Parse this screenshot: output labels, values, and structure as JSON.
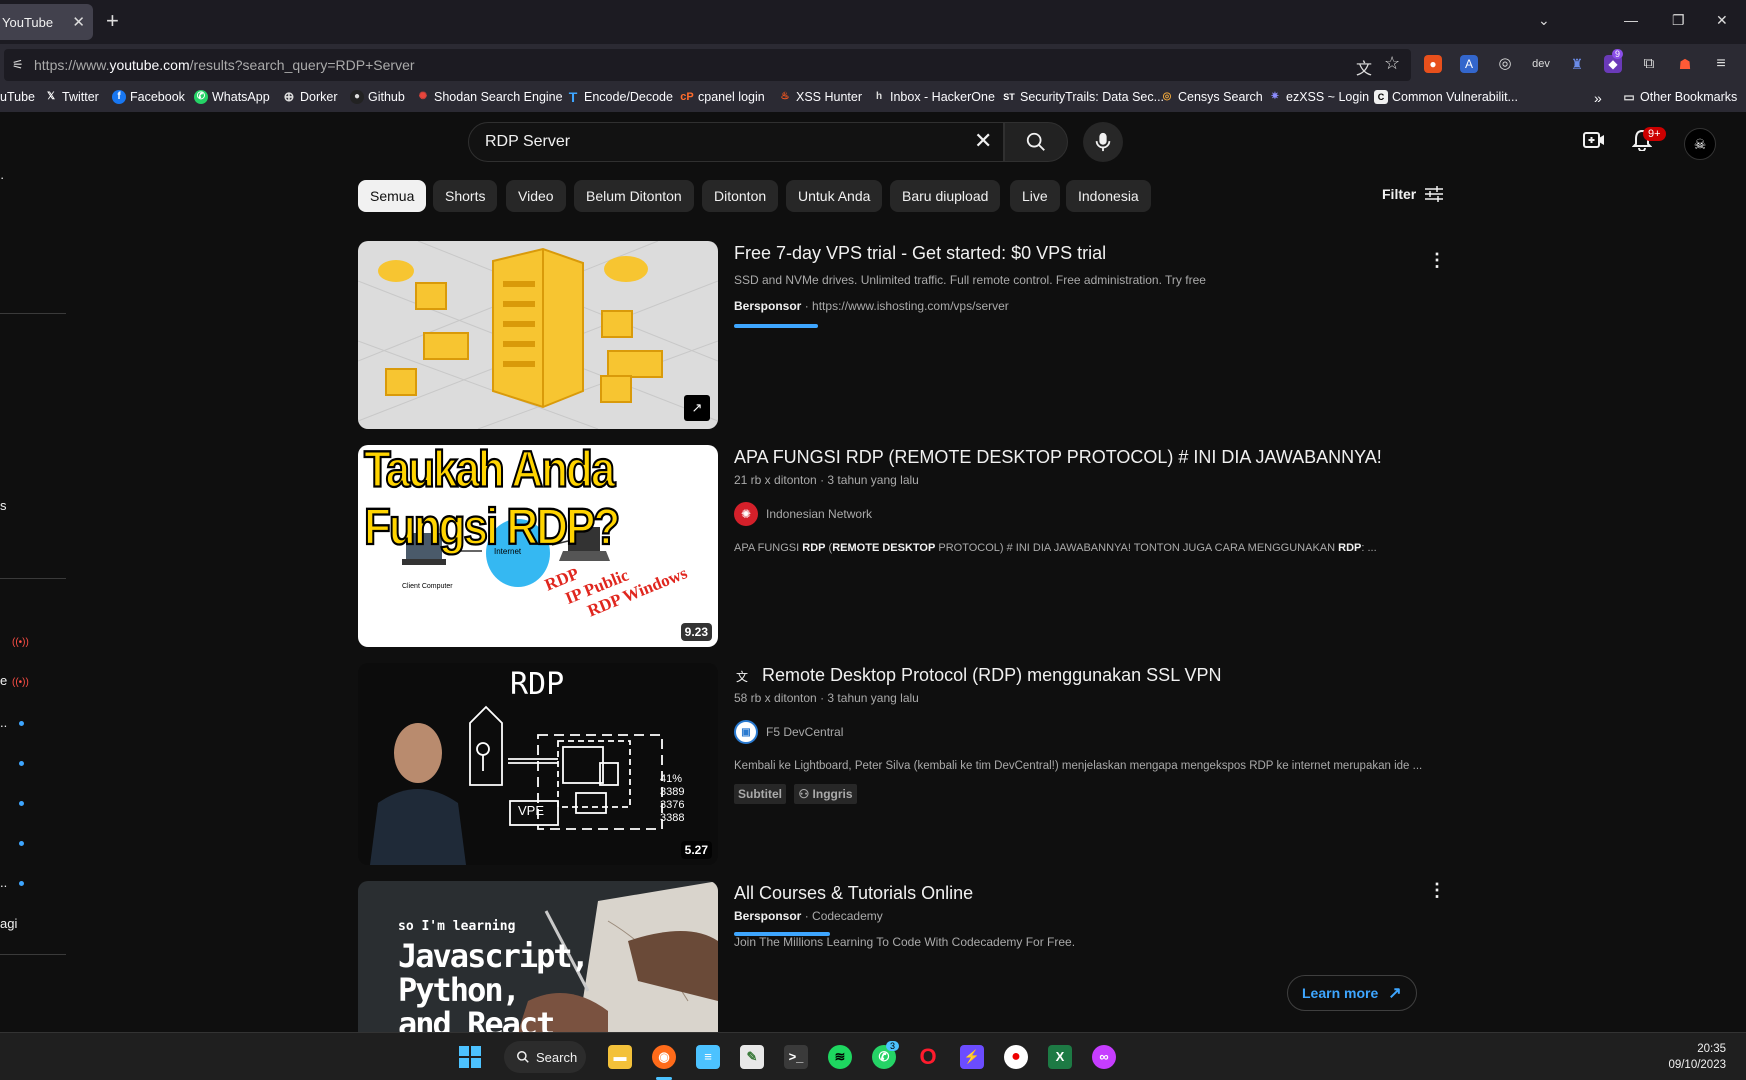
{
  "browser": {
    "tab_title": "YouTube",
    "url_prefix": "https://www.",
    "url_host": "youtube.com",
    "url_path": "/results?search_query=RDP+Server"
  },
  "bookmarks": [
    {
      "label": "uTube",
      "icon": "youtube-icon"
    },
    {
      "label": "Twitter",
      "icon": "x-icon"
    },
    {
      "label": "Facebook",
      "icon": "facebook-icon"
    },
    {
      "label": "WhatsApp",
      "icon": "whatsapp-icon"
    },
    {
      "label": "Dorker",
      "icon": "globe-icon"
    },
    {
      "label": "Github",
      "icon": "github-icon"
    },
    {
      "label": "Shodan Search Engine",
      "icon": "shodan-icon"
    },
    {
      "label": "Encode/Decode",
      "icon": "t-icon"
    },
    {
      "label": "cpanel login",
      "icon": "cpanel-icon"
    },
    {
      "label": "XSS Hunter",
      "icon": "flame-icon"
    },
    {
      "label": "Inbox - HackerOne",
      "icon": "hackerone-icon"
    },
    {
      "label": "SecurityTrails: Data Sec...",
      "icon": "st-icon"
    },
    {
      "label": "Censys Search",
      "icon": "censys-icon"
    },
    {
      "label": "ezXSS ~ Login",
      "icon": "ezxss-icon"
    },
    {
      "label": "Common Vulnerabilit...",
      "icon": "cve-icon"
    },
    {
      "label": "Other Bookmarks",
      "icon": "folder-icon"
    }
  ],
  "search": {
    "query": "RDP Server"
  },
  "header": {
    "notification_count": "9+",
    "ext_badge": "9"
  },
  "chips": [
    "Semua",
    "Shorts",
    "Video",
    "Belum Ditonton",
    "Ditonton",
    "Untuk Anda",
    "Baru diupload",
    "Live",
    "Indonesia"
  ],
  "filter_label": "Filter",
  "results": {
    "ad1": {
      "title": "Free 7-day VPS trial - Get started: $0 VPS trial",
      "description": "SSD and NVMe drives. Unlimited traffic. Full remote control. Free administration. Try free",
      "sponsored": "Bersponsor",
      "separator": "·",
      "url": "https://www.ishosting.com/vps/server"
    },
    "video1": {
      "title": "APA FUNGSI RDP (REMOTE DESKTOP PROTOCOL) # INI DIA JAWABANNYA!",
      "views": "21 rb x ditonton",
      "age": "3 tahun yang lalu",
      "separator": "·",
      "channel": "Indonesian Network",
      "desc_1": "APA FUNGSI ",
      "desc_2": "RDP",
      "desc_3": " (",
      "desc_4": "REMOTE DESKTOP",
      "desc_5": " PROTOCOL) # INI DIA JAWABANNYA! TONTON JUGA CARA MENGGUNAKAN ",
      "desc_6": "RDP",
      "desc_7": ": ...",
      "duration": "9.23",
      "thumb_text": "Taukah Anda Fungsi RDP?",
      "thumb_internet": "Internet",
      "thumb_client": "Client Computer",
      "thumb_l1": "RDP",
      "thumb_l2": "IP Public",
      "thumb_l3": "RDP Windows"
    },
    "video2": {
      "title": "Remote Desktop Protocol (RDP) menggunakan SSL VPN",
      "views": "58 rb x ditonton",
      "age": "3 tahun yang lalu",
      "separator": "·",
      "channel": "F5 DevCentral",
      "description": "Kembali ke Lightboard, Peter Silva (kembali ke tim DevCentral!) menjelaskan mengapa mengekspos RDP ke internet merupakan ide ...",
      "badge_subtitle": "Subtitel",
      "badge_lang": "Inggris",
      "duration": "5.27",
      "thumb_text": "RDP",
      "thumb_vpe": "VPE",
      "thumb_ports": "41% 3389 3376 3388"
    },
    "ad2": {
      "title": "All Courses & Tutorials Online",
      "sponsored": "Bersponsor",
      "separator": "·",
      "advertiser": "Codecademy",
      "description": "Join The Millions Learning To Code With Codecademy For Free.",
      "cta": "Learn more",
      "thumb_small": "so I'm learning",
      "thumb_l1": "Javascript,",
      "thumb_l2": "Python,",
      "thumb_l3": "and React"
    }
  },
  "taskbar": {
    "search_label": "Search",
    "whatsapp_badge": "3",
    "time": "20:35",
    "date": "09/10/2023"
  }
}
